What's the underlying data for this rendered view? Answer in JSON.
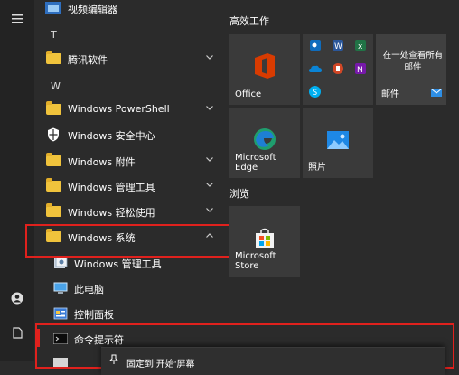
{
  "list": {
    "video_editor": "视频编辑器",
    "section_t": "T",
    "tencent": "腾讯软件",
    "section_w": "W",
    "powershell": "Windows PowerShell",
    "security": "Windows 安全中心",
    "accessories": "Windows 附件",
    "admin_tools": "Windows 管理工具",
    "ease": "Windows 轻松使用",
    "system": "Windows 系统",
    "sub_admin_tools": "Windows 管理工具",
    "this_pc": "此电脑",
    "control_panel": "控制面板",
    "cmd": "命令提示符"
  },
  "tiles": {
    "group1": "高效工作",
    "office": "Office",
    "mail_text": "在一处查看所有邮件",
    "mail": "邮件",
    "edge": "Microsoft Edge",
    "photos": "照片",
    "group2": "浏览",
    "store": "Microsoft Store"
  },
  "context_menu": {
    "pin": "固定到'开始'屏幕"
  },
  "colors": {
    "highlight": "#e0211d",
    "folder": "#f0c33c",
    "tile": "#3a3a3a",
    "accent": "#0078d7"
  }
}
